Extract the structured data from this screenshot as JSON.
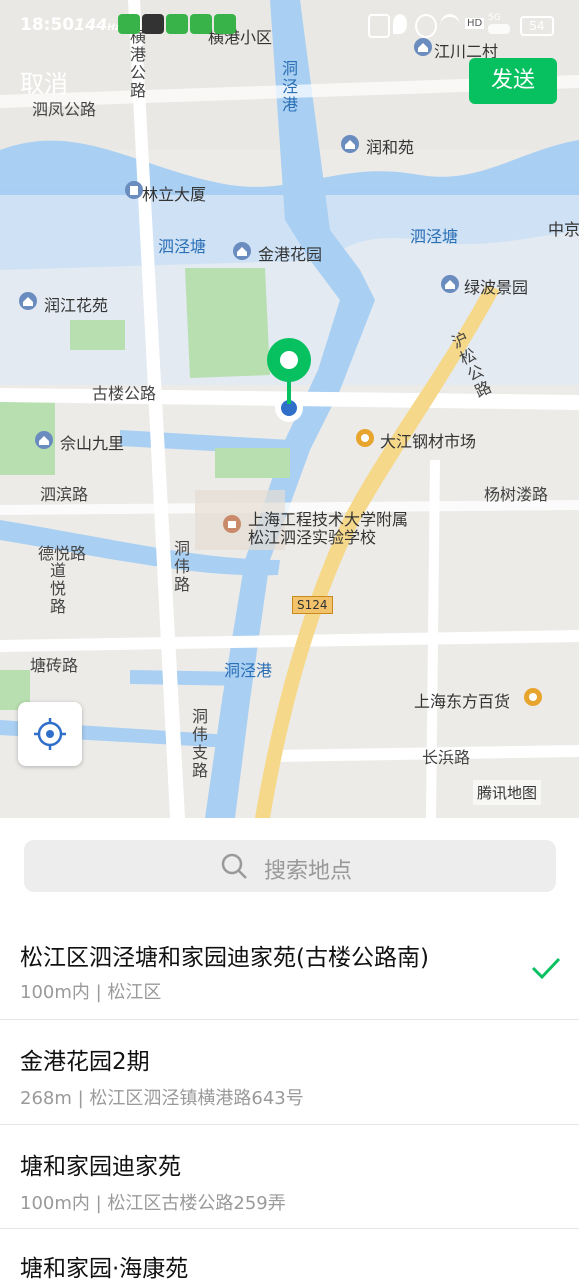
{
  "status_bar": {
    "time": "18:50",
    "rate": "144",
    "rate_unit": "Hz",
    "battery": "54",
    "network": "5G",
    "hd": "HD"
  },
  "header": {
    "cancel_label": "取消",
    "send_label": "发送"
  },
  "map": {
    "labels": {
      "henggang_road": "横港公路",
      "henggang_xiaoqu": "横港小区",
      "jiangchuan": "江川二村",
      "sifeng_road": "泗凤公路",
      "dongjinggang_top": "洞泾港",
      "runhe": "润和苑",
      "linli": "林立大厦",
      "sijingtang_left": "泗泾塘",
      "jingang": "金港花园",
      "sijingtang_right": "泗泾塘",
      "zhongjing": "中京",
      "runjiang": "润江花苑",
      "lvbo": "绿波景园",
      "husong_road": "沪松公路",
      "gulou_road": "古楼公路",
      "sheshan": "佘山九里",
      "dajiang": "大江钢材市场",
      "sibin_road": "泗滨路",
      "yangshulou": "杨树溇路",
      "school_line1": "上海工程技术大学附属",
      "school_line2": "松江泗泾实验学校",
      "deyue_road": "德悦路",
      "daoyue_road": "道悦路",
      "dongwei_road": "洞伟路",
      "s124": "S124",
      "tangzhuan_road": "塘砖路",
      "dongjinggang_bottom": "洞泾港",
      "dongfang": "上海东方百货",
      "dongweizhi_road": "洞伟支路",
      "changbin_road": "长浜路",
      "watermark": "腾讯地图"
    }
  },
  "search": {
    "placeholder": "搜索地点"
  },
  "results": [
    {
      "title": "松江区泗泾塘和家园迪家苑(古楼公路南)",
      "subtitle": "100m内 | 松江区",
      "selected": true
    },
    {
      "title": "金港花园2期",
      "subtitle": "268m | 松江区泗泾镇横港路643号",
      "selected": false
    },
    {
      "title": "塘和家园迪家苑",
      "subtitle": "100m内 | 松江区古楼公路259弄",
      "selected": false
    },
    {
      "title": "塘和家园·海康苑",
      "subtitle": "",
      "selected": false
    }
  ],
  "colors": {
    "accent": "#07c160",
    "water": "#a9cff3",
    "green": "#b8dfb0",
    "road_major": "#f6d88a"
  }
}
